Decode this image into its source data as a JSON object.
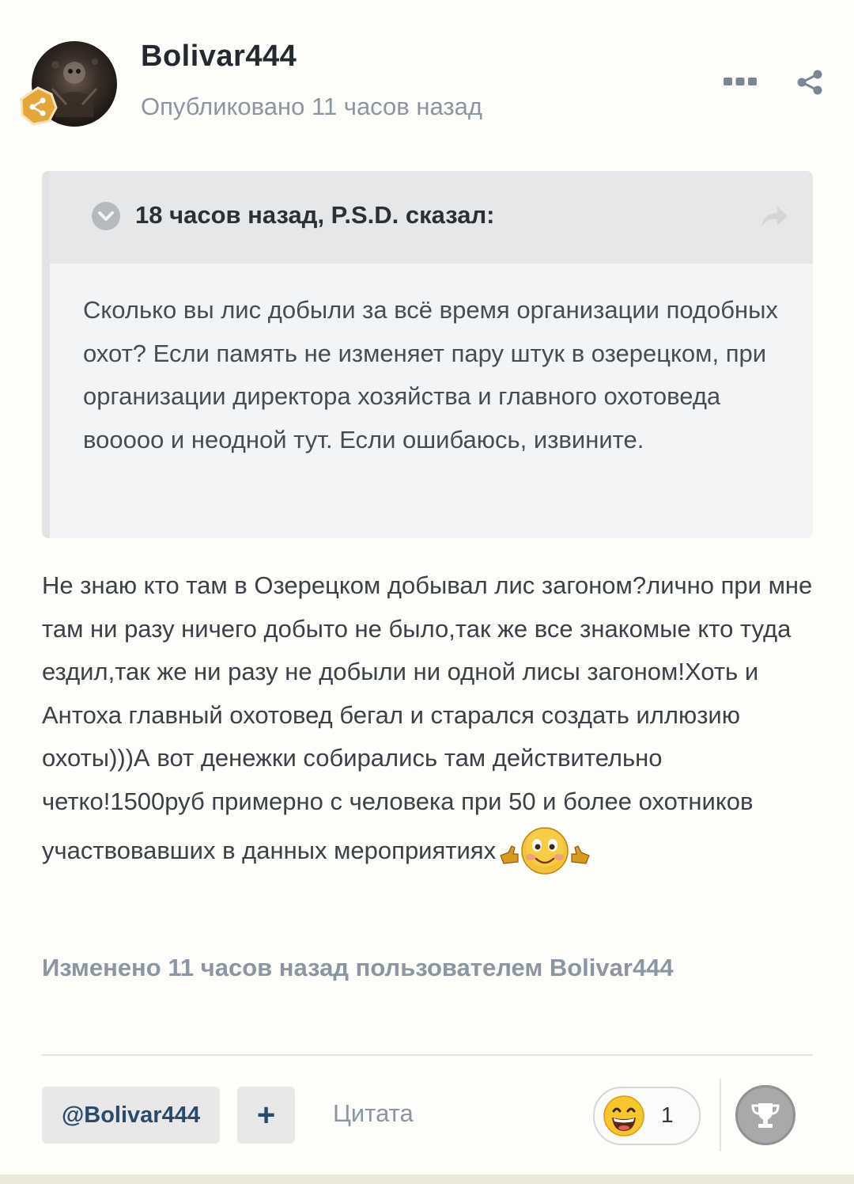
{
  "author": {
    "name": "Bolivar444",
    "published": "Опубликовано 11 часов назад"
  },
  "header_actions": {
    "more_icon": "ellipsis-icon",
    "share_icon": "share-icon"
  },
  "quote": {
    "citation": "18 часов назад, P.S.D. сказал:",
    "text": "Сколько вы лис добыли за всё время организации подобных охот? Если память не изменяет пару штук в озерецком, при организации директора хозяйства и главного охотоведа вооооо и неодной тут. Если ошибаюсь, извините."
  },
  "body": {
    "text": "Не знаю кто там в Озерецком добывал лис загоном?лично при мне там ни разу ничего добыто не было,так же все знакомые кто туда ездил,так же ни разу не добыли ни одной лисы загоном!Хоть и Антоха главный охотовед бегал и старался создать иллюзию охоты)))А вот денежки собирались там действительно  четко!1500руб примерно с человека при 50 и более охотников участвовавших в данных мероприятиях",
    "emoji": "thumbs-up-smiley-icon"
  },
  "edited_note": "Изменено 11 часов назад пользователем Bolivar444",
  "footer": {
    "mention_label": "@Bolivar444",
    "plus_label": "+",
    "quote_label": "Цитата",
    "reaction_count": "1",
    "reaction_icon": "laughing-emoji-icon",
    "trophy_icon": "trophy-icon"
  },
  "colors": {
    "background": "#fdfdfa",
    "muted_text": "#8c96a2",
    "accent_link": "#2a4a6b",
    "badge": "#e0a030"
  }
}
